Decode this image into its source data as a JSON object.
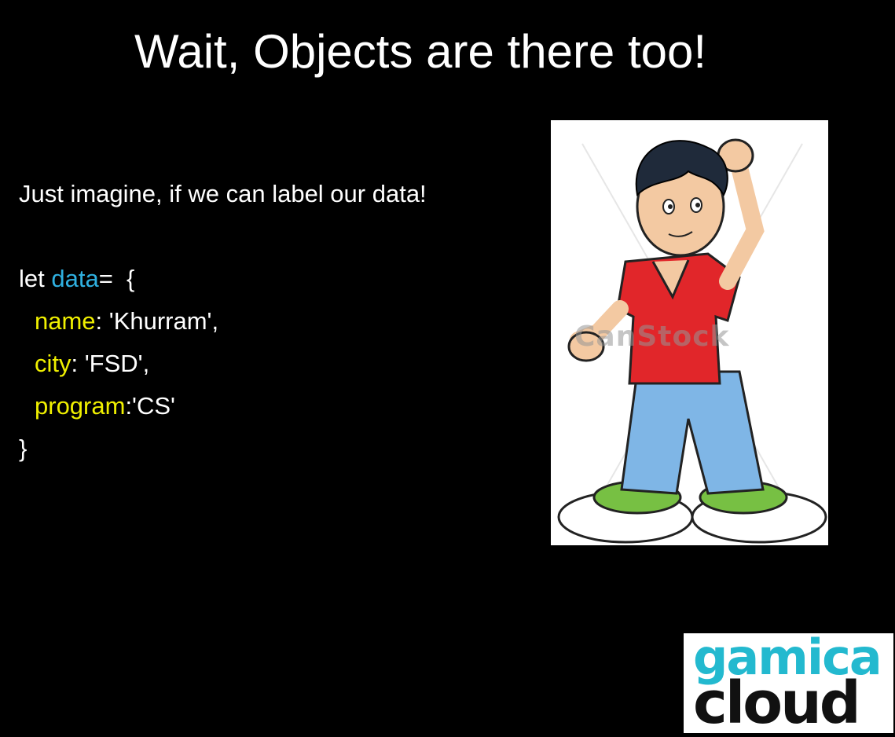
{
  "slide": {
    "title": "Wait, Objects are there too!",
    "intro": "Just imagine, if we can label our data!",
    "code": {
      "let_kw": "let ",
      "var_name": "data",
      "assign": "=  {",
      "props": [
        {
          "key": "name",
          "value": ": 'Khurram',"
        },
        {
          "key": "city",
          "value": ": 'FSD',"
        },
        {
          "key": "program",
          "value": ":'CS'"
        }
      ],
      "close": "}"
    }
  },
  "illustration": {
    "watermark": "CanStock",
    "subject": "confused-cartoon-boy"
  },
  "logo": {
    "line1": "gamica",
    "line2": "cloud"
  },
  "colors": {
    "background": "#000000",
    "text": "#ffffff",
    "identifier": "#2fb0e0",
    "property": "#f0f000",
    "logo_accent": "#23b9cf"
  }
}
